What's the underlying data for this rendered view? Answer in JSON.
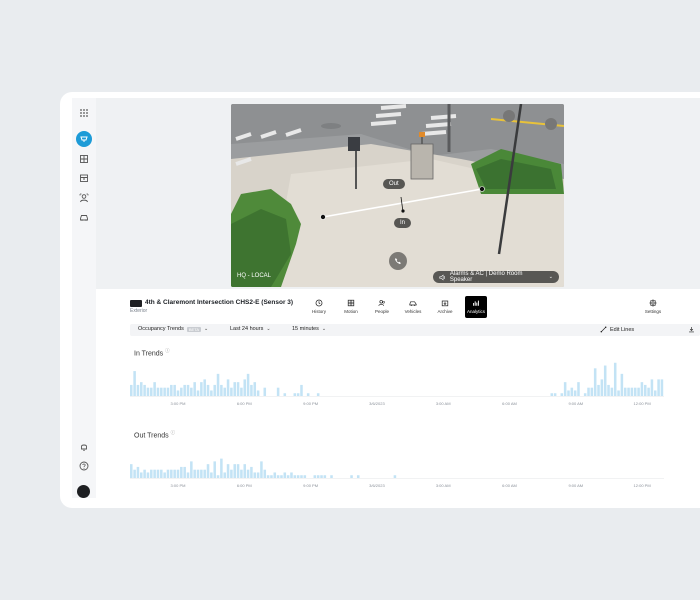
{
  "sidebar": {
    "items": [
      {
        "icon": "grid-icon"
      },
      {
        "icon": "camera-icon",
        "active": true
      },
      {
        "icon": "building-icon"
      },
      {
        "icon": "archive-icon"
      },
      {
        "icon": "people-icon"
      },
      {
        "icon": "vehicle-icon"
      }
    ],
    "bottom": [
      {
        "icon": "bell-icon"
      },
      {
        "icon": "help-icon"
      }
    ]
  },
  "camera": {
    "location_label": "HQ - LOCAL",
    "speaker_label": "Alarms & AC | Demo Room Speaker",
    "line_labels": {
      "out": "Out",
      "in": "In"
    },
    "title": "4th & Claremont Intersection CHS2-E (Sensor 3)",
    "subtitle": "Exterior"
  },
  "toolbar": [
    {
      "label": "History",
      "icon": "history-icon"
    },
    {
      "label": "Motion",
      "icon": "motion-icon"
    },
    {
      "label": "People",
      "icon": "people-icon"
    },
    {
      "label": "Vehicles",
      "icon": "vehicle-icon"
    },
    {
      "label": "Archive",
      "icon": "archive-icon"
    },
    {
      "label": "Analytics",
      "icon": "analytics-icon",
      "active": true
    },
    {
      "label": "Settings",
      "icon": "gear-icon"
    }
  ],
  "filters": {
    "metric": "Occupancy Trends",
    "badge": "BETA",
    "range": "Last 24 hours",
    "interval": "15 minutes",
    "edit_lines": "Edit Lines"
  },
  "colors": {
    "bar": "#c3e3f5",
    "accent": "#1d9bd7"
  },
  "chart_data": [
    {
      "type": "bar",
      "title": "In Trends",
      "x_ticks": [
        "3:00 PM",
        "6:00 PM",
        "9:00 PM",
        "3/6/2023",
        "3:00 AM",
        "6:00 AM",
        "9:00 AM",
        "12:00 PM"
      ],
      "values": [
        4,
        9,
        4,
        5,
        4,
        3,
        3,
        5,
        3,
        3,
        3,
        3,
        4,
        4,
        2,
        3,
        4,
        4,
        3,
        5,
        2,
        5,
        6,
        4,
        2,
        4,
        8,
        4,
        3,
        6,
        3,
        5,
        5,
        3,
        6,
        8,
        4,
        5,
        2,
        0,
        3,
        0,
        0,
        0,
        3,
        0,
        1,
        0,
        0,
        1,
        1,
        4,
        0,
        1,
        0,
        0,
        1,
        0,
        0,
        0,
        0,
        0,
        0,
        0,
        0,
        0,
        0,
        0,
        0,
        0,
        0,
        0,
        0,
        0,
        0,
        0,
        0,
        0,
        0,
        0,
        0,
        0,
        0,
        0,
        0,
        0,
        0,
        0,
        0,
        0,
        0,
        0,
        0,
        0,
        0,
        0,
        0,
        0,
        0,
        0,
        0,
        0,
        0,
        0,
        0,
        0,
        0,
        0,
        0,
        0,
        0,
        0,
        0,
        0,
        0,
        0,
        0,
        0,
        0,
        0,
        0,
        0,
        0,
        0,
        0,
        0,
        1,
        1,
        0,
        1,
        5,
        2,
        3,
        2,
        5,
        0,
        1,
        3,
        3,
        10,
        4,
        6,
        11,
        4,
        3,
        12,
        2,
        8,
        3,
        3,
        3,
        3,
        3,
        5,
        4,
        3,
        6,
        2,
        6,
        6
      ],
      "ylim": [
        0,
        13
      ]
    },
    {
      "type": "bar",
      "title": "Out Trends",
      "x_ticks": [
        "3:00 PM",
        "6:00 PM",
        "9:00 PM",
        "3/6/2023",
        "3:00 AM",
        "6:00 AM",
        "9:00 AM",
        "12:00 PM"
      ],
      "values": [
        5,
        3,
        4,
        2,
        3,
        2,
        3,
        3,
        3,
        3,
        2,
        3,
        3,
        3,
        3,
        4,
        4,
        2,
        6,
        3,
        3,
        3,
        3,
        5,
        2,
        6,
        1,
        7,
        2,
        5,
        3,
        5,
        5,
        3,
        5,
        3,
        4,
        2,
        2,
        6,
        3,
        1,
        1,
        2,
        1,
        1,
        2,
        1,
        2,
        1,
        1,
        1,
        1,
        0,
        0,
        1,
        1,
        1,
        1,
        0,
        1,
        0,
        0,
        0,
        0,
        0,
        1,
        0,
        1,
        0,
        0,
        0,
        0,
        0,
        0,
        0,
        0,
        0,
        0,
        1,
        0,
        0,
        0,
        0,
        0,
        0,
        0,
        0,
        0,
        0,
        0,
        0,
        0,
        0,
        0,
        0,
        0,
        0,
        0,
        0,
        0,
        0,
        0,
        0,
        0,
        0,
        0,
        0,
        0,
        0,
        0,
        0,
        0,
        0,
        0,
        0,
        0,
        0,
        0,
        0,
        0,
        0,
        0,
        0,
        0,
        0,
        0,
        0,
        0,
        0,
        0,
        0,
        0,
        0,
        0,
        0,
        0,
        0,
        0,
        0,
        0,
        0,
        0,
        0,
        0,
        0,
        0,
        0,
        0,
        0,
        0,
        0,
        0,
        0,
        0,
        0,
        0,
        0,
        0,
        0
      ],
      "ylim": [
        0,
        13
      ]
    }
  ]
}
